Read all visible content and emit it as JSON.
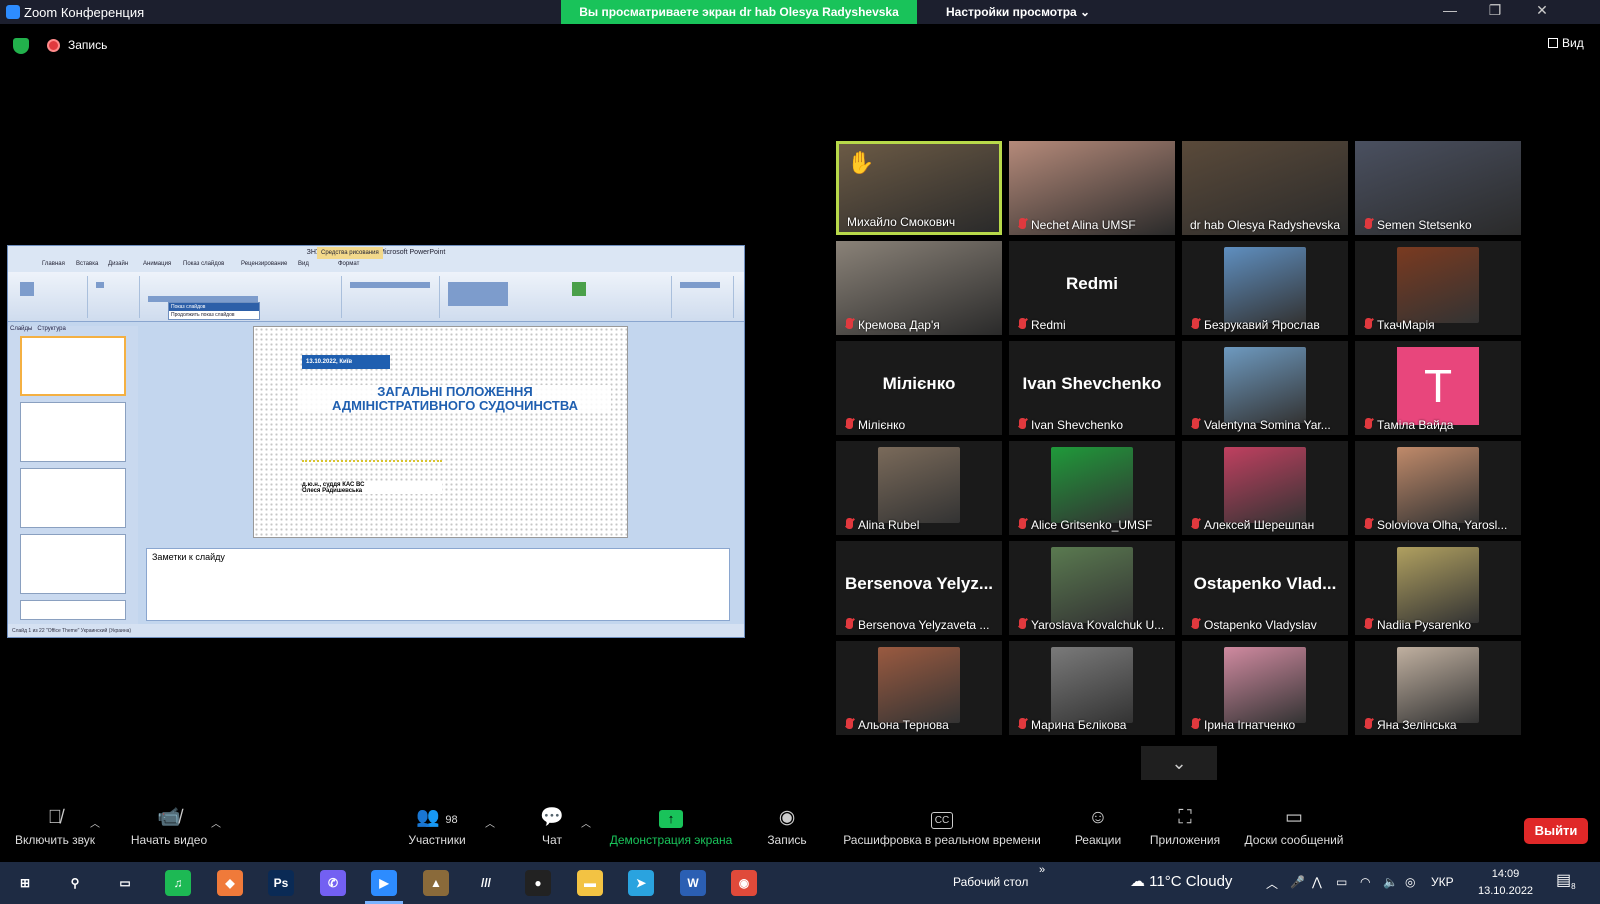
{
  "window": {
    "title": "Zoom Конференция",
    "share_banner": "Вы просматриваете экран dr hab Olesya Radyshevska",
    "view_settings": "Настройки просмотра",
    "view_settings_icon": "chevron-down-icon",
    "minimize": "—",
    "maximize": "❐",
    "close": "✕"
  },
  "meeting_bar": {
    "recording_label": "Запись",
    "view_label": "Вид"
  },
  "shared_screen": {
    "window_title": "ЗНУ-13.10.2022.pptx - Microsoft PowerPoint",
    "context_tab": "Средства рисования",
    "tabs": [
      "Главная",
      "Вставка",
      "Дизайн",
      "Анимация",
      "Показ слайдов",
      "Рецензирование",
      "Вид",
      "Формат"
    ],
    "side_tabs": [
      "Слайды",
      "Структура"
    ],
    "slideshow_popup": [
      "Показ слайдов",
      "Продолжить показ слайдов"
    ],
    "slide": {
      "date": "13.10.2022, Київ",
      "title_line1": "ЗАГАЛЬНІ ПОЛОЖЕННЯ",
      "title_line2": "АДМІНІСТРАТИВНОГО СУДОЧИНСТВА",
      "author_line1": "д.ю.н., суддя КАС ВС",
      "author_line2": "Олеся Радишевська"
    },
    "notes_placeholder": "Заметки к слайду",
    "status_text": "Слайд 1 из 22    \"Office Theme\"    Украинский (Украина)"
  },
  "participants": [
    {
      "name": "Михайло Смокович",
      "muted": false,
      "hand_raised": true,
      "highlighted": true,
      "kind": "video",
      "color": "#6b5a45"
    },
    {
      "name": "Nechet Alina UMSF",
      "muted": true,
      "kind": "video",
      "color": "#b58a7a"
    },
    {
      "name": "dr hab Olesya Radyshevska",
      "muted": false,
      "kind": "video",
      "color": "#5a4a3a"
    },
    {
      "name": "Semen Stetsenko",
      "muted": true,
      "kind": "video",
      "color": "#4a5060"
    },
    {
      "name": "Кремова Дар'я",
      "muted": true,
      "kind": "video",
      "color": "#8a8278"
    },
    {
      "name": "Redmi",
      "muted": true,
      "kind": "text",
      "display": "Redmi"
    },
    {
      "name": "Безрукавий Ярослав",
      "muted": true,
      "kind": "photo",
      "color": "#5f8fc0"
    },
    {
      "name": "ТкачМарія",
      "muted": true,
      "kind": "photo",
      "color": "#7a3a20"
    },
    {
      "name": "Мілієнко",
      "muted": true,
      "kind": "text",
      "display": "Мілієнко"
    },
    {
      "name": "Ivan Shevchenko",
      "muted": true,
      "kind": "text",
      "display": "Ivan Shevchenko"
    },
    {
      "name": "Valentyna Somina Yar...",
      "muted": true,
      "kind": "photo",
      "color": "#6e9ac0"
    },
    {
      "name": "Таміла Вайда",
      "muted": true,
      "kind": "letter",
      "display": "T"
    },
    {
      "name": "Alina Rubel",
      "muted": true,
      "kind": "photo",
      "color": "#7a6a5a"
    },
    {
      "name": "Alice Gritsenko_UMSF",
      "muted": true,
      "kind": "photo",
      "color": "#1f9a3a"
    },
    {
      "name": "Алексей Шерешпан",
      "muted": true,
      "kind": "photo",
      "color": "#c04060"
    },
    {
      "name": "Soloviova Olha, Yarosl...",
      "muted": true,
      "kind": "photo",
      "color": "#c08a6a"
    },
    {
      "name": "Bersenova Yelyzaveta ...",
      "muted": true,
      "kind": "text",
      "display": "Bersenova  Yelyz..."
    },
    {
      "name": "Yaroslava Kovalchuk U...",
      "muted": true,
      "kind": "photo",
      "color": "#5a7a50"
    },
    {
      "name": "Ostapenko Vladyslav",
      "muted": true,
      "kind": "text",
      "display": "Ostapenko  Vlad..."
    },
    {
      "name": "Nadiia Pysarenko",
      "muted": true,
      "kind": "photo",
      "color": "#b0a060"
    },
    {
      "name": "Альона Тернова",
      "muted": true,
      "kind": "photo",
      "color": "#9a5a40"
    },
    {
      "name": "Марина Бєлікова",
      "muted": true,
      "kind": "photo",
      "color": "#7a7a7a"
    },
    {
      "name": "Ірина Ігнатченко",
      "muted": true,
      "kind": "photo",
      "color": "#d08aa0"
    },
    {
      "name": "Яна Зелінська",
      "muted": true,
      "kind": "photo",
      "color": "#c0b0a0"
    }
  ],
  "toolbar": {
    "unmute": "Включить звук",
    "start_video": "Начать видео",
    "participants": "Участники",
    "participants_count": "98",
    "chat": "Чат",
    "share_screen": "Демонстрация экрана",
    "record": "Запись",
    "live_transcript": "Расшифровка в реальном времени",
    "transcript_badge": "CC",
    "reactions": "Реакции",
    "apps": "Приложения",
    "whiteboards": "Доски сообщений",
    "leave": "Выйти"
  },
  "taskbar": {
    "desktop_label": "Рабочий стол",
    "desktop_chevron": "»",
    "weather": "11°C  Cloudy",
    "lang": "УКР",
    "time": "14:09",
    "date": "13.10.2022",
    "notifications": "8",
    "apps": [
      {
        "name": "windows-start-icon",
        "label": "⊞",
        "color": "transparent"
      },
      {
        "name": "search-icon",
        "label": "⚲",
        "color": "transparent"
      },
      {
        "name": "task-view-icon",
        "label": "▭",
        "color": "transparent"
      },
      {
        "name": "spotify-icon",
        "label": "♫",
        "color": "#1db954"
      },
      {
        "name": "app-orange-icon",
        "label": "◆",
        "color": "#f07a3a"
      },
      {
        "name": "photoshop-icon",
        "label": "Ps",
        "color": "#0a2a55"
      },
      {
        "name": "viber-icon",
        "label": "✆",
        "color": "#7360f2"
      },
      {
        "name": "zoom-icon",
        "label": "▶",
        "color": "#2d8cff"
      },
      {
        "name": "app-figure-icon",
        "label": "▲",
        "color": "#8a6a3a"
      },
      {
        "name": "app-lines-icon",
        "label": "///",
        "color": "transparent"
      },
      {
        "name": "recorder-icon",
        "label": "●",
        "color": "#222"
      },
      {
        "name": "file-explorer-icon",
        "label": "▬",
        "color": "#f3c343"
      },
      {
        "name": "telegram-icon",
        "label": "➤",
        "color": "#2aa3df"
      },
      {
        "name": "word-icon",
        "label": "W",
        "color": "#2b5fb3"
      },
      {
        "name": "chrome-icon",
        "label": "◉",
        "color": "#e04a3a"
      }
    ]
  }
}
